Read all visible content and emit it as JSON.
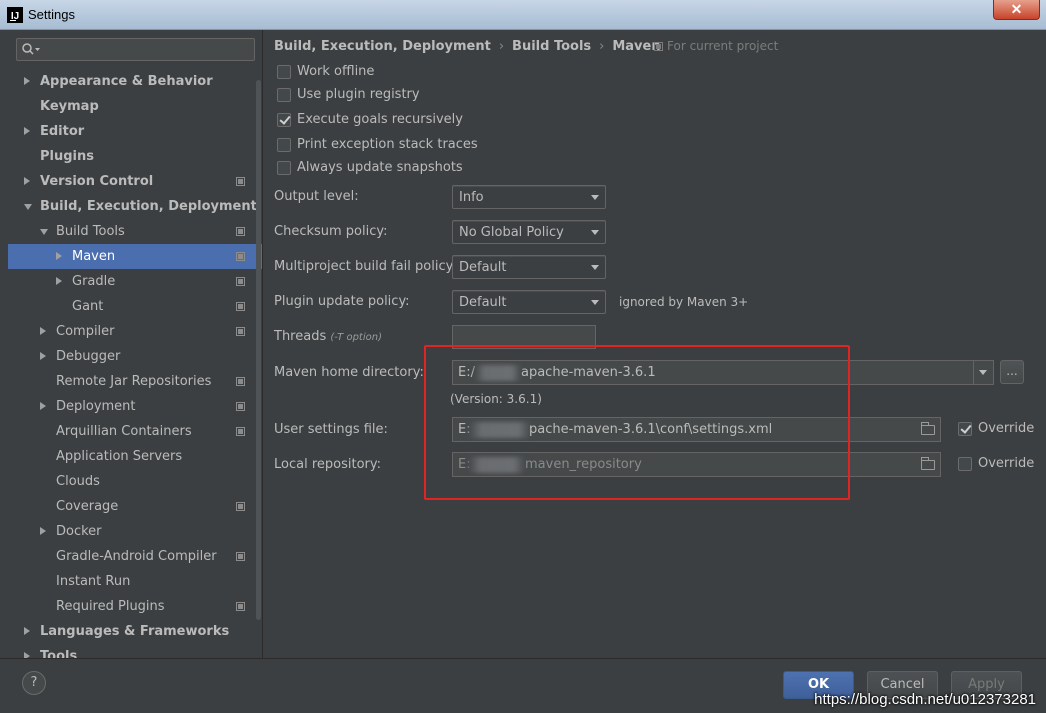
{
  "window": {
    "title": "Settings",
    "close_glyph": "✕"
  },
  "search": {
    "placeholder": ""
  },
  "tree": [
    {
      "label": "Appearance & Behavior",
      "indent": 0,
      "arrow": "right",
      "bold": true,
      "proj": false
    },
    {
      "label": "Keymap",
      "indent": 0,
      "arrow": "",
      "bold": true,
      "proj": false
    },
    {
      "label": "Editor",
      "indent": 0,
      "arrow": "right",
      "bold": true,
      "proj": false
    },
    {
      "label": "Plugins",
      "indent": 0,
      "arrow": "",
      "bold": true,
      "proj": false
    },
    {
      "label": "Version Control",
      "indent": 0,
      "arrow": "right",
      "bold": true,
      "proj": true
    },
    {
      "label": "Build, Execution, Deployment",
      "indent": 0,
      "arrow": "down",
      "bold": true,
      "proj": false
    },
    {
      "label": "Build Tools",
      "indent": 1,
      "arrow": "down",
      "bold": false,
      "proj": true
    },
    {
      "label": "Maven",
      "indent": 2,
      "arrow": "right",
      "bold": false,
      "proj": true,
      "selected": true
    },
    {
      "label": "Gradle",
      "indent": 2,
      "arrow": "right",
      "bold": false,
      "proj": true
    },
    {
      "label": "Gant",
      "indent": 2,
      "arrow": "",
      "bold": false,
      "proj": true
    },
    {
      "label": "Compiler",
      "indent": 1,
      "arrow": "right",
      "bold": false,
      "proj": true
    },
    {
      "label": "Debugger",
      "indent": 1,
      "arrow": "right",
      "bold": false,
      "proj": false
    },
    {
      "label": "Remote Jar Repositories",
      "indent": 1,
      "arrow": "",
      "bold": false,
      "proj": true
    },
    {
      "label": "Deployment",
      "indent": 1,
      "arrow": "right",
      "bold": false,
      "proj": true
    },
    {
      "label": "Arquillian Containers",
      "indent": 1,
      "arrow": "",
      "bold": false,
      "proj": true
    },
    {
      "label": "Application Servers",
      "indent": 1,
      "arrow": "",
      "bold": false,
      "proj": false
    },
    {
      "label": "Clouds",
      "indent": 1,
      "arrow": "",
      "bold": false,
      "proj": false
    },
    {
      "label": "Coverage",
      "indent": 1,
      "arrow": "",
      "bold": false,
      "proj": true
    },
    {
      "label": "Docker",
      "indent": 1,
      "arrow": "right",
      "bold": false,
      "proj": false
    },
    {
      "label": "Gradle-Android Compiler",
      "indent": 1,
      "arrow": "",
      "bold": false,
      "proj": true
    },
    {
      "label": "Instant Run",
      "indent": 1,
      "arrow": "",
      "bold": false,
      "proj": false
    },
    {
      "label": "Required Plugins",
      "indent": 1,
      "arrow": "",
      "bold": false,
      "proj": true
    },
    {
      "label": "Languages & Frameworks",
      "indent": 0,
      "arrow": "right",
      "bold": true,
      "proj": false
    },
    {
      "label": "Tools",
      "indent": 0,
      "arrow": "right",
      "bold": true,
      "proj": false
    }
  ],
  "breadcrumb": {
    "part1": "Build, Execution, Deployment",
    "part2": "Build Tools",
    "part3": "Maven",
    "sep": "›"
  },
  "for_project": "For current project",
  "checkboxes": [
    {
      "label": "Work offline",
      "checked": false
    },
    {
      "label": "Use plugin registry",
      "checked": false
    },
    {
      "label": "Execute goals recursively",
      "checked": true
    },
    {
      "label": "Print exception stack traces",
      "checked": false
    },
    {
      "label": "Always update snapshots",
      "checked": false
    }
  ],
  "output_level": {
    "label": "Output level:",
    "value": "Info"
  },
  "checksum_policy": {
    "label": "Checksum policy:",
    "value": "No Global Policy"
  },
  "multiproject_policy": {
    "label": "Multiproject build fail policy:",
    "value": "Default"
  },
  "plugin_update_policy": {
    "label": "Plugin update policy:",
    "value": "Default",
    "note": "ignored by Maven 3+"
  },
  "threads": {
    "label": "Threads",
    "hint": "(-T option)",
    "value": ""
  },
  "maven_home": {
    "label": "Maven home directory:",
    "prefix": "E:/",
    "suffix": "apache-maven-3.6.1",
    "ellipsis": "..."
  },
  "version": "(Version: 3.6.1)",
  "user_settings": {
    "label": "User settings file:",
    "prefix": "E:",
    "suffix": "pache-maven-3.6.1\\conf\\settings.xml",
    "override_label": "Override",
    "override_checked": true
  },
  "local_repo": {
    "label": "Local repository:",
    "prefix": "E:",
    "suffix": "maven_repository",
    "override_label": "Override",
    "override_checked": false
  },
  "buttons": {
    "help": "?",
    "ok": "OK",
    "cancel": "Cancel",
    "apply": "Apply"
  },
  "watermark": "https://blog.csdn.net/u012373281",
  "colors": {
    "background": "#3c3f41",
    "selection": "#4b6eaf",
    "highlight_box": "#e02424",
    "text": "#bbbbbb"
  }
}
